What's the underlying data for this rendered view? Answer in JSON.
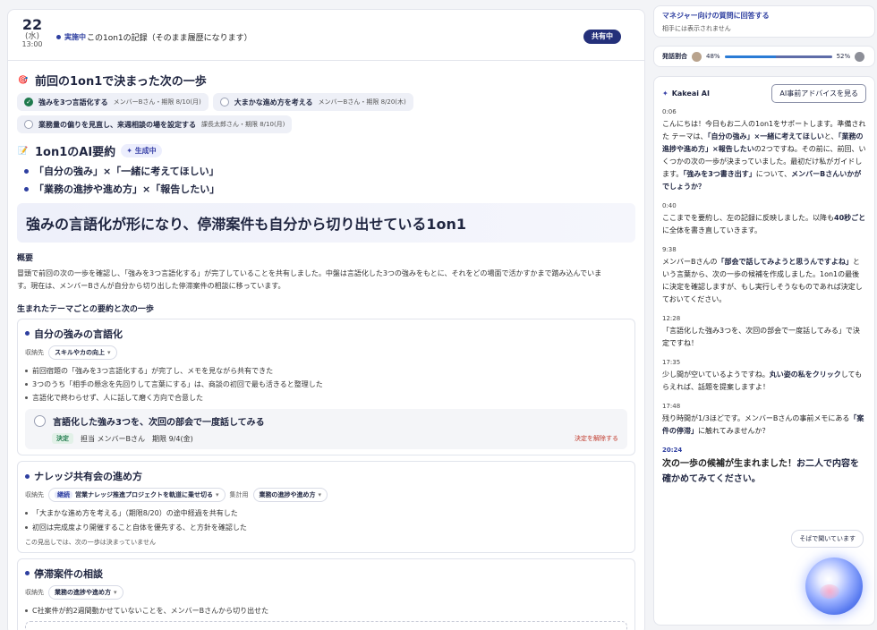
{
  "header": {
    "day": "22",
    "weekday": "(水)",
    "time": "13:00",
    "status": "実施中",
    "record_text": "この1on1の記録（そのまま履歴になります）",
    "share_label": "共有中"
  },
  "next_steps": {
    "title": "前回の1on1で決まった次の一歩",
    "items": [
      {
        "text": "強みを3つ言語化する",
        "meta": "メンバーBさん・期限 8/10(月)",
        "done": true
      },
      {
        "text": "大まかな進め方を考える",
        "meta": "メンバーBさん・期限 8/20(木)",
        "done": false
      },
      {
        "text": "業務量の偏りを見直し、来週相談の場を設定する",
        "meta": "課長太郎さん・期限 8/10(月)",
        "done": false
      }
    ]
  },
  "ai_summary": {
    "title": "1on1のAI要約",
    "badge": "生成中",
    "themes": [
      "「自分の強み」×「一緒に考えてほしい」",
      "「業務の進捗や進め方」×「報告したい」"
    ],
    "headline": "強みの言語化が形になり、停滞案件も自分から切り出せている1on1",
    "overview_label": "概要",
    "overview_line1": "冒頭で前回の次の一歩を確認し、「強みを3つ言語化する」が完了していることを共有しました。中盤は言語化した3つの強みをもとに、それをどの場面で活かすかまで踏み込んでいま",
    "overview_line2": "す。現在は、メンバーBさんが自分から切り出した停滞案件の相談に移っています。",
    "themes_label": "生まれたテーマごとの要約と次の一歩"
  },
  "cards": [
    {
      "title": "自分の強みの言語化",
      "store_label": "収納先",
      "tag": "スキルやカの向上",
      "bullets": [
        "前回宿題の「強みを3つ言語化する」が完了し、メモを見ながら共有できた",
        "3つのうち「相手の懸念を先回りして言葉にする」は、商談の初回で最も活きると整理した",
        "言語化で終わらせず、人に話して磨く方向で合意した"
      ],
      "decision": {
        "text": "言語化した強み3つを、次回の部会で一度話してみる",
        "badge": "決定",
        "owner": "担当 メンバーBさん",
        "due": "期限 9/4(金)",
        "undo": "決定を解除する"
      }
    },
    {
      "title": "ナレッジ共有会の進め方",
      "store_label": "収納先",
      "tag_prefix": "継続",
      "tag": "営業ナレッジ推進プロジェクトを軌道に乗せ切る",
      "tag2_label": "集計用",
      "tag2": "業務の進捗や進め方",
      "bullets": [
        "「大まかな進め方を考える」（期限8/20）の途中経過を共有した",
        "初回は完成度より開催すること自体を優先する、と方針を確認した"
      ],
      "note": "この見出しでは、次の一歩は決まっていません"
    },
    {
      "title": "停滞案件の相談",
      "store_label": "収納先",
      "tag": "業務の進捗や進め方",
      "bullets": [
        "C社案件が約2週間動かせていないことを、メンバーBさんから切り出せた"
      ]
    }
  ],
  "right": {
    "manager_title": "マネジャー向けの質問に回答する",
    "manager_sub": "相手には表示されません",
    "speech_label": "発話割合",
    "speech_left": "48%",
    "speech_right": "52%",
    "speech_left_ratio": 0.48,
    "kakeai_title": "Kakeai AI",
    "advice_button": "AI事前アドバイスを見る",
    "listen_button": "そばで聞いています",
    "messages": [
      {
        "time": "0:06",
        "segs": [
          [
            "こんにちは！今日もお二人の1on1をサポートします。準備された テーマは、",
            false
          ],
          [
            "「自分の強み」×一緒に考えてほしい",
            true
          ],
          [
            "と、",
            false
          ],
          [
            "「業務の進捗や進め方」×報告したい",
            true
          ],
          [
            "の2つですね。その前に、前回、いくつかの次の一歩が決まっていました。最初だけ私がガイドします。",
            false
          ],
          [
            "「強みを3つ書き出す」",
            true
          ],
          [
            "について、",
            false
          ],
          [
            "メンバーBさんいかがでしょうか？",
            true
          ]
        ]
      },
      {
        "time": "0:40",
        "segs": [
          [
            "ここまでを要約し、左の記録に反映しました。以降も",
            false
          ],
          [
            "40秒ごと",
            true
          ],
          [
            "に全体を書き直していきます。",
            false
          ]
        ]
      },
      {
        "time": "9:38",
        "segs": [
          [
            "メンバーBさんの",
            false
          ],
          [
            "「部会で話してみようと思うんですよね」",
            true
          ],
          [
            "という言葉から、次の一歩の候補を作成しました。1on1の最後に決定を確認しますが、もし実行しそうなものであれば決定しておいてください。",
            false
          ]
        ]
      },
      {
        "time": "12:28",
        "segs": [
          [
            "「言語化した強み3つを、次回の部会で一度話してみる」で決定ですね！",
            false
          ]
        ]
      },
      {
        "time": "17:35",
        "segs": [
          [
            "少し間が空いているようですね。",
            false
          ],
          [
            "丸い姿の私をクリック",
            true
          ],
          [
            "してもらえれば、話題を提案しますよ！",
            false
          ]
        ]
      },
      {
        "time": "17:48",
        "segs": [
          [
            "残り時間が1/3ほどです。メンバーBさんの事前メモにある",
            false
          ],
          [
            "「案件の停滞」",
            true
          ],
          [
            "に触れてみませんか？",
            false
          ]
        ]
      },
      {
        "time": "20:24",
        "segs": [
          [
            "次の一歩の候補が生まれました！",
            false
          ],
          [
            "お二人で内容を確かめてみてください。",
            true
          ]
        ]
      }
    ]
  },
  "colors": {
    "brand": "#24307a",
    "accent": "#2e3fa0",
    "done": "#1f7a4d",
    "danger": "#c0392b"
  }
}
